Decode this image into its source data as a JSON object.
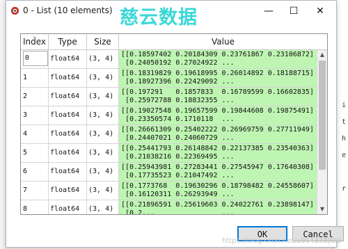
{
  "window": {
    "title": "0 - List (10 elements)"
  },
  "watermark": "慈云数据",
  "background_right_chars": [
    "i",
    "t",
    "h",
    "e",
    "r"
  ],
  "columns": {
    "index": "Index",
    "type": "Type",
    "size": "Size",
    "value": "Value"
  },
  "rows": [
    {
      "index": "0",
      "type": "float64",
      "size": "(3, 4)",
      "value": "[[0.18597402 0.20184309 0.23761867 0.23106872]\n [0.24050192 0.27024922 ..."
    },
    {
      "index": "1",
      "type": "float64",
      "size": "(3, 4)",
      "value": "[[0.18319829 0.19618995 0.26014892 0.18188715]\n [0.18927396 0.22429092 ..."
    },
    {
      "index": "2",
      "type": "float64",
      "size": "(3, 4)",
      "value": "[[0.197291   0.1857833  0.16789599 0.16602835]\n [0.25972788 0.18832355 ..."
    },
    {
      "index": "3",
      "type": "float64",
      "size": "(3, 4)",
      "value": "[[0.19027548 0.19657599 0.19844608 0.19875491]\n [0.23350574 0.1710118  ..."
    },
    {
      "index": "4",
      "type": "float64",
      "size": "(3, 4)",
      "value": "[[0.26661309 0.25402222 0.26969759 0.27711949]\n [0.24407021 0.24060729 ..."
    },
    {
      "index": "5",
      "type": "float64",
      "size": "(3, 4)",
      "value": "[[0.25441793 0.26148842 0.22137385 0.23540363]\n [0.21038216 0.22369495 ..."
    },
    {
      "index": "6",
      "type": "float64",
      "size": "(3, 4)",
      "value": "[[0.25943981 0.27283441 0.27545947 0.17640308]\n [0.17735523 0.21047492 ..."
    },
    {
      "index": "7",
      "type": "float64",
      "size": "(3, 4)",
      "value": "[[0.1773768  0.19630296 0.18798482 0.24558607]\n [0.16120311 0.26293949 ..."
    },
    {
      "index": "8",
      "type": "float64",
      "size": "(3, 4)",
      "value": "[[0.21896591 0.25619603 0.24022761 0.23898147]\n [0.2...                ..."
    }
  ],
  "buttons": {
    "ok": "OK",
    "cancel": "Cancel"
  },
  "footer_credit": "https://blog.csdn.net/u014338920",
  "colors": {
    "value_bg": "#bff5b3",
    "ok_border": "#0078d7",
    "watermark": "#19d1d1"
  }
}
